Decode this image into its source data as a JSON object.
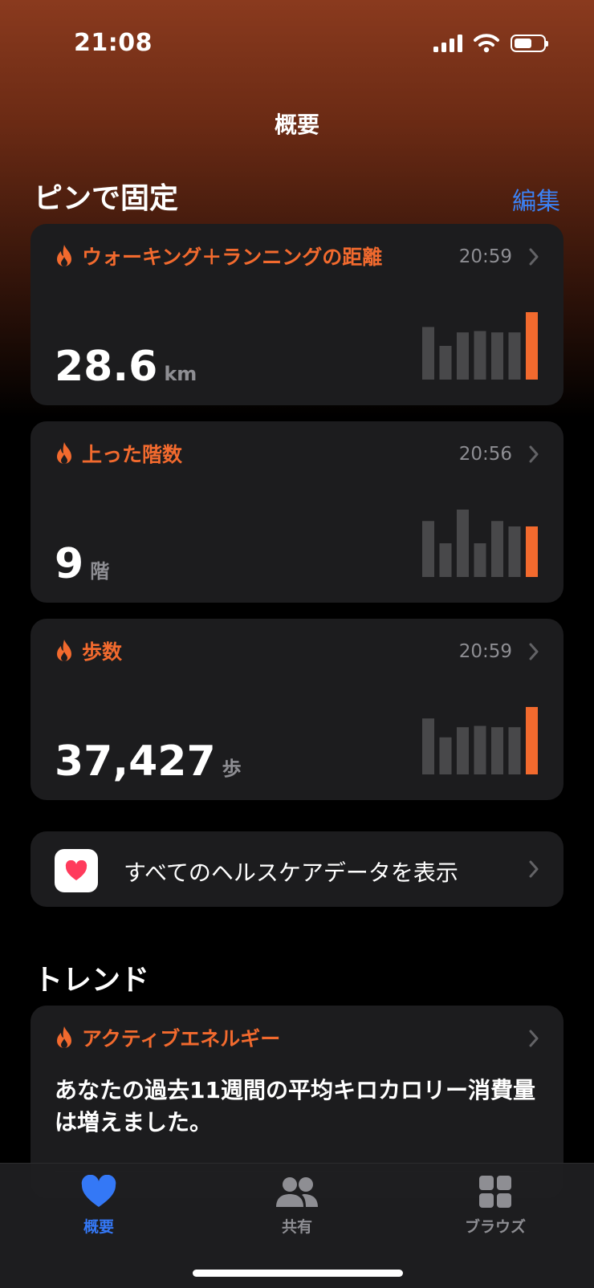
{
  "status_bar": {
    "time": "21:08",
    "battery_level": 0.62
  },
  "nav": {
    "title": "概要"
  },
  "pinned": {
    "title": "ピンで固定",
    "edit_label": "編集",
    "cards": [
      {
        "title": "ウォーキング＋ランニングの距離",
        "time": "20:59",
        "value": "28.6",
        "unit": "km",
        "bars": [
          0.78,
          0.5,
          0.7,
          0.72,
          0.7,
          0.7,
          1.0
        ]
      },
      {
        "title": "上った階数",
        "time": "20:56",
        "value": "9",
        "unit": "階",
        "bars": [
          0.83,
          0.5,
          1.0,
          0.5,
          0.83,
          0.75,
          0.75
        ]
      },
      {
        "title": "歩数",
        "time": "20:59",
        "value": "37,427",
        "unit": "歩",
        "bars": [
          0.83,
          0.55,
          0.7,
          0.72,
          0.7,
          0.7,
          1.0
        ]
      }
    ]
  },
  "all_data": {
    "label": "すべてのヘルスケアデータを表示"
  },
  "trends": {
    "title": "トレンド",
    "card": {
      "title": "アクティブエネルギー",
      "text": "あなたの過去11週間の平均キロカロリー消費量は増えました。"
    }
  },
  "tabbar": {
    "tabs": [
      {
        "label": "概要",
        "icon": "heart-icon",
        "active": true
      },
      {
        "label": "共有",
        "icon": "people-icon",
        "active": false
      },
      {
        "label": "ブラウズ",
        "icon": "grid-icon",
        "active": false
      }
    ]
  },
  "colors": {
    "accent": "#f26a2e",
    "link": "#3b82f6",
    "card": "#1c1c1e",
    "bar_inactive": "#48484a"
  }
}
